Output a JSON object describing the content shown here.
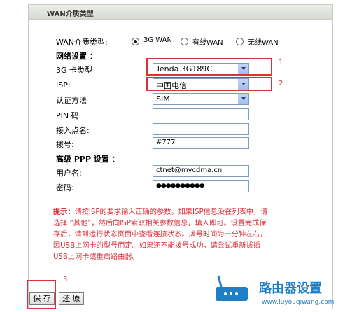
{
  "header": {
    "title": "WAN介质类型"
  },
  "wan_type": {
    "label": "WAN介质类型:",
    "options": [
      "3G WAN",
      "有线WAN",
      "无线WAN"
    ],
    "selected": "3G WAN"
  },
  "network": {
    "section_title": "网络设置 ：",
    "card_type": {
      "label": "3G 卡类型",
      "value": "Tenda 3G189C"
    },
    "isp": {
      "label": "ISP:",
      "value": "中国电信"
    },
    "auth": {
      "label": "认证方法",
      "value": "SIM"
    },
    "pin": {
      "label": "PIN 码:",
      "value": ""
    },
    "apn": {
      "label": "接入点名:",
      "value": ""
    },
    "dial": {
      "label": "拨号:",
      "value": "#777"
    }
  },
  "ppp": {
    "section_title": "高级 PPP 设置 ：",
    "username": {
      "label": "用户名:",
      "value": "ctnet@mycdma.cn"
    },
    "password": {
      "label": "密码:",
      "value": "●●●●●●●●●●"
    }
  },
  "hint": {
    "prefix": "提示：",
    "text": "请按ISP的要求输入正确的参数，如果ISP信息没在列表中，请选择 “其他”，然后向ISP索取相关参数信息，填入即可。设置完成保存后，请到运行状态页面中查看连接状态。拨号时间为一分钟左右，因USB上网卡的型号而定。如果还不能拨号成功，请尝试重新拔插USB上网卡或重启路由器。"
  },
  "buttons": {
    "save": "保 存",
    "reset": "还 原"
  },
  "annotations": {
    "a1": "1",
    "a2": "2",
    "a3": "3"
  },
  "watermark": {
    "title": "路由器设置",
    "url": "www.luyouqiwang.com"
  },
  "colors": {
    "annotation_red": "#d9323a",
    "watermark_blue": "#1e7fc6"
  }
}
